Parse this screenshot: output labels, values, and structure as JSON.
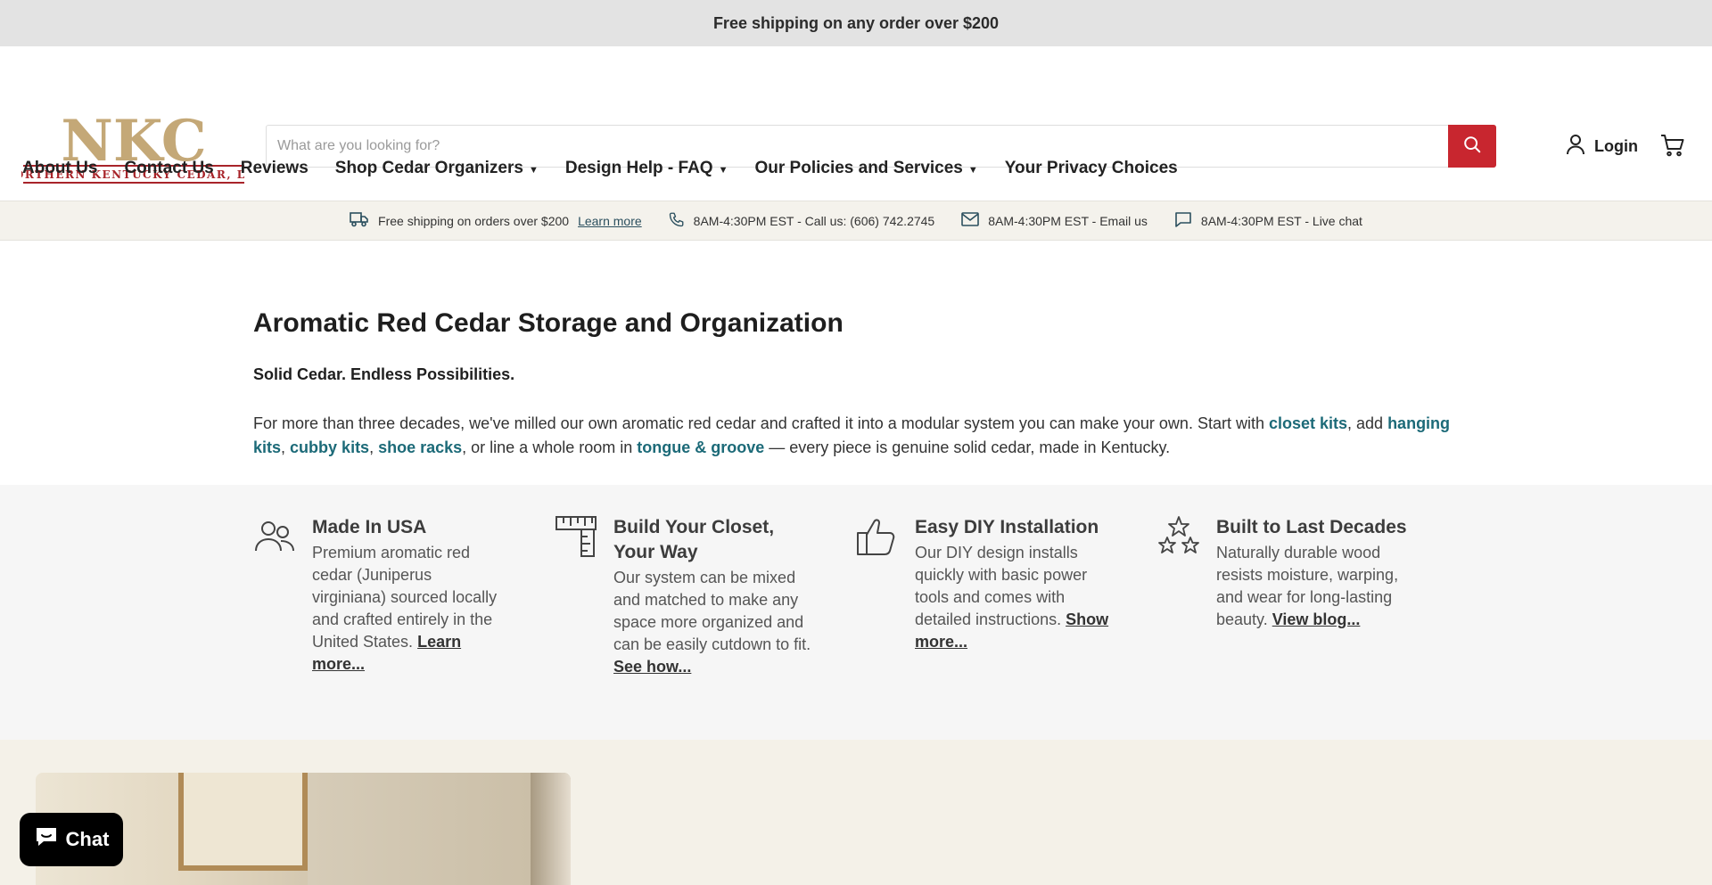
{
  "announcement": "Free shipping on any order over $200",
  "logo": {
    "monogram": "NKC",
    "company": "NORTHERN KENTUCKY CEDAR, LLC"
  },
  "search": {
    "placeholder": "What are you looking for?",
    "value": ""
  },
  "header": {
    "login_label": "Login"
  },
  "nav": {
    "items": [
      {
        "label": "About Us",
        "has_dropdown": false
      },
      {
        "label": "Contact Us",
        "has_dropdown": false
      },
      {
        "label": "Reviews",
        "has_dropdown": false
      },
      {
        "label": "Shop Cedar Organizers",
        "has_dropdown": true
      },
      {
        "label": "Design Help - FAQ",
        "has_dropdown": true
      },
      {
        "label": "Our Policies and Services",
        "has_dropdown": true
      },
      {
        "label": "Your Privacy Choices",
        "has_dropdown": false
      }
    ]
  },
  "infobar": {
    "shipping_text": "Free shipping on orders over $200",
    "shipping_link": "Learn more",
    "call_text": "8AM-4:30PM EST - Call us: (606) 742.2745",
    "email_text": "8AM-4:30PM EST - Email us",
    "chat_text": "8AM-4:30PM EST - Live chat"
  },
  "intro": {
    "title": "Aromatic Red Cedar Storage and Organization",
    "tagline": "Solid Cedar. Endless Possibilities.",
    "p_start": "For more than three decades, we've milled our own aromatic red cedar and crafted it into a modular system you can make your own. Start with ",
    "link_closet": "closet kits",
    "sep_add": ", add ",
    "link_hanging": "hanging kits",
    "sep_comma1": ", ",
    "link_cubby": "cubby kits",
    "sep_comma2": ", ",
    "link_shoe": "shoe racks",
    "sep_line": ", or line a whole room in ",
    "link_tongue": "tongue & groove",
    "p_end": " — every piece is genuine solid cedar, made in Kentucky."
  },
  "features": [
    {
      "icon": "people-icon",
      "title": "Made In USA",
      "text": "Premium aromatic red cedar (Juniperus virginiana) sourced locally and crafted entirely in the United States. ",
      "link": "Learn more..."
    },
    {
      "icon": "ruler-icon",
      "title": "Build Your Closet, Your Way",
      "text": "Our system can be mixed and matched to make any space more organized and can be easily cutdown to fit. ",
      "link": "See how..."
    },
    {
      "icon": "thumbs-up-icon",
      "title": "Easy DIY Installation",
      "text": "Our DIY design installs quickly with basic power tools and comes with detailed instructions. ",
      "link": "Show more..."
    },
    {
      "icon": "stars-icon",
      "title": "Built to Last Decades",
      "text": "Naturally durable wood resists moisture, warping, and wear for long-lasting beauty. ",
      "link": "View blog..."
    }
  ],
  "chat": {
    "label": "Chat"
  },
  "colors": {
    "brand_red": "#c8262f",
    "logo_tan": "#c4a877",
    "link_teal": "#1c6a78"
  }
}
